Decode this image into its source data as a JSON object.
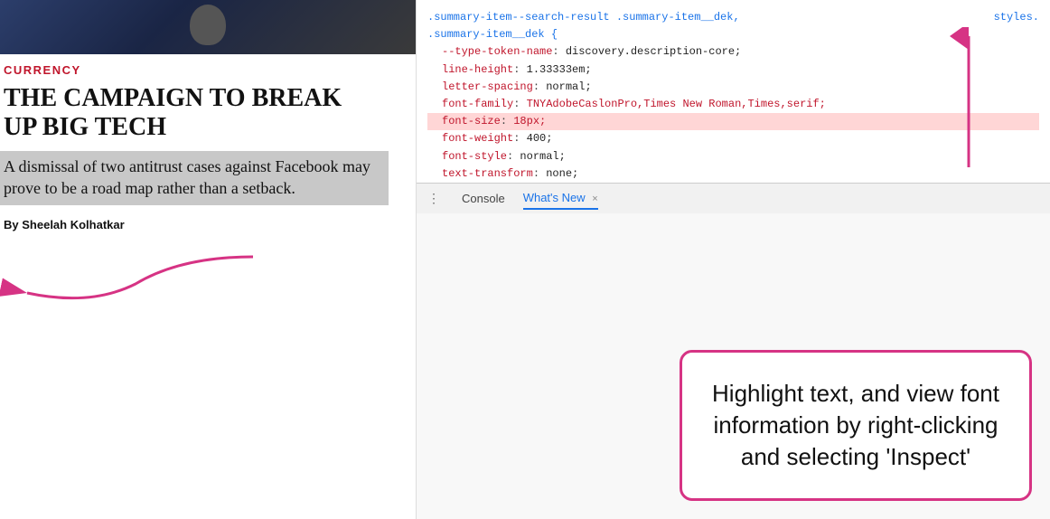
{
  "left": {
    "currency_label": "CURRENCY",
    "headline": "THE CAMPAIGN TO BREAK UP BIG TECH",
    "dek": "A dismissal of two antitrust cases against Facebook may prove to be a road map rather than a setback.",
    "byline_label": "By",
    "byline_name": "Sheelah Kolhatkar"
  },
  "devtools": {
    "selector_line1": ".summary-item--search-result .summary-item__dek,",
    "selector_line2": ".summary-item__dek {",
    "props": [
      {
        "name": "--type-token-name",
        "value": "discovery.description-core;",
        "red": false
      },
      {
        "name": "line-height",
        "value": "1.33333em;",
        "red": false
      },
      {
        "name": "letter-spacing",
        "value": "normal;",
        "red": false
      },
      {
        "name": "font-family",
        "value": "TNYAdobeCaslonPro,Times New Roman,Times,serif;",
        "red": true,
        "highlighted": false
      },
      {
        "name": "font-size",
        "value": "18px;",
        "red": true,
        "highlighted": true
      },
      {
        "name": "font-weight",
        "value": "400;",
        "red": false
      },
      {
        "name": "font-style",
        "value": "normal;",
        "red": false
      },
      {
        "name": "text-transform",
        "value": "none;",
        "red": false
      }
    ],
    "closing_brace": "}",
    "styles_link": "styles."
  },
  "tabs": {
    "dots": "⋮",
    "console_label": "Console",
    "whats_new_label": "What's New",
    "close_icon": "×"
  },
  "tooltip": {
    "text": "Highlight text, and view font information by right-clicking and selecting 'Inspect'"
  },
  "colors": {
    "red": "#c0152b",
    "pink_arrow": "#d63384",
    "blue": "#1a73e8"
  }
}
